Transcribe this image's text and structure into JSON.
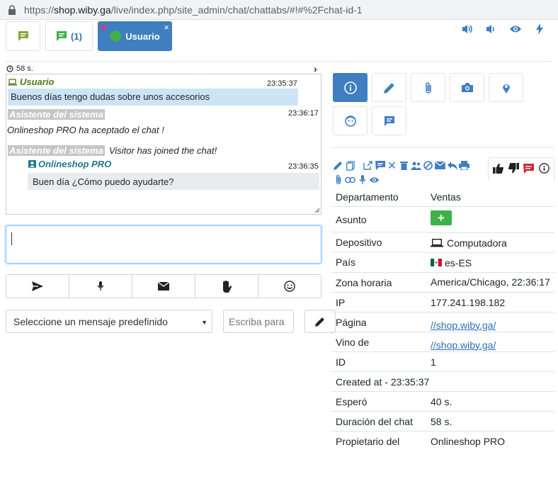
{
  "browser": {
    "url_scheme": "https://",
    "url_host": "shop.wiby.ga",
    "url_path": "/live/index.php/site_admin/chat/chattabs/#!#%2Fchat-id-1"
  },
  "tabs": [
    {
      "label": ""
    },
    {
      "count": "(1)"
    },
    {
      "label": "Usuario",
      "close": "×"
    }
  ],
  "chat": {
    "timer": "58 s.",
    "messages": [
      {
        "author": "Usuario",
        "time": "23:35:37",
        "text": "Buenos días tengo dudas sobre unos accesorios"
      },
      {
        "author": "Asistente del sistema",
        "time": "23:36:17",
        "text": "Onlineshop PRO ha aceptado el chat !"
      },
      {
        "author": "Asistente del sistema",
        "text": "Visitor has joined the chat!"
      },
      {
        "author": "Onlineshop PRO",
        "time": "23:36:35",
        "text": "Buen día ¿Cómo puedo ayudarte?"
      }
    ]
  },
  "composer": {
    "predefined_select": "Seleccione un mensaje predefinido",
    "type_placeholder": "Escriba para"
  },
  "info": {
    "rows": [
      {
        "key": "Departamento",
        "value": "Ventas"
      },
      {
        "key": "Asunto",
        "value": "+"
      },
      {
        "key": "Depositivo",
        "value": "Computadora"
      },
      {
        "key": "País",
        "value": "es-ES"
      },
      {
        "key": "Zona horaria",
        "value": "America/Chicago, 22:36:17"
      },
      {
        "key": "IP",
        "value": "177.241.198.182"
      },
      {
        "key": "Página",
        "value": "//shop.wiby.ga/"
      },
      {
        "key": "Vino de",
        "value": "//shop.wiby.ga/"
      },
      {
        "key": "ID",
        "value": "1"
      },
      {
        "key": "Created at - 23:35:37",
        "value": ""
      },
      {
        "key": "Esperó",
        "value": "40 s."
      },
      {
        "key": "Duración del chat",
        "value": "58 s."
      },
      {
        "key": "Propietario del",
        "value": "Onlineshop PRO"
      }
    ]
  },
  "colors": {
    "primary": "#3f7ec0",
    "user_green": "#4e7a1a",
    "operator_teal": "#1b7a8c",
    "highlight": "#cce5f6",
    "op_bg": "#e9ecef",
    "success": "#3fb04a",
    "danger": "#d9232d"
  },
  "icons": {
    "tab1": "chat-icon",
    "tab2": "chat-icon",
    "header": [
      "volume-icon",
      "volume-low-icon",
      "eye-icon",
      "flash-icon"
    ],
    "action_buttons": [
      "send-icon",
      "mic-icon",
      "envelope-icon",
      "hand-icon",
      "smile-icon"
    ],
    "right_buttons": [
      "info-icon",
      "pencil-icon",
      "paperclip-icon",
      "camera-icon",
      "location-icon",
      "face-icon",
      "message-icon"
    ]
  }
}
